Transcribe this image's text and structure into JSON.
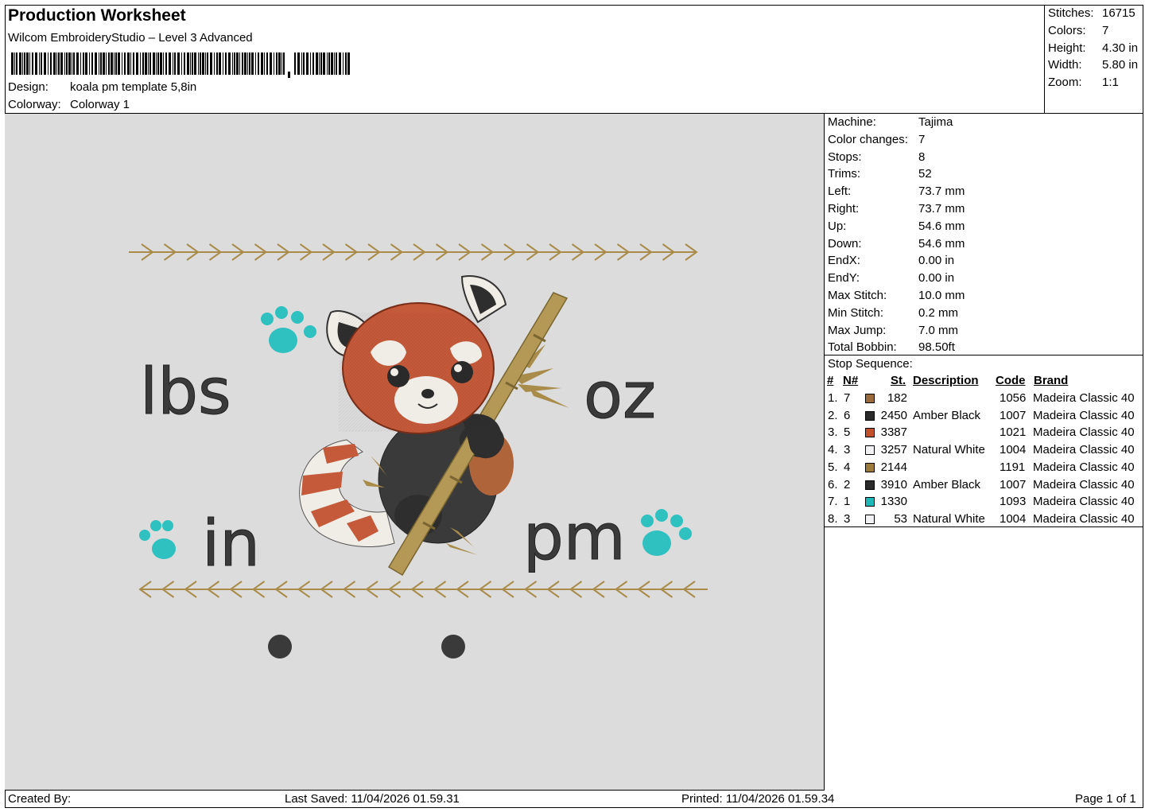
{
  "header": {
    "title": "Production Worksheet",
    "software": "Wilcom EmbroideryStudio – Level 3 Advanced",
    "design_label": "Design:",
    "design_value": "koala pm template 5,8in",
    "colorway_label": "Colorway:",
    "colorway_value": "Colorway 1"
  },
  "stats": [
    {
      "label": "Stitches:",
      "value": "16715"
    },
    {
      "label": "Colors:",
      "value": "7"
    },
    {
      "label": "Height:",
      "value": "4.30 in"
    },
    {
      "label": "Width:",
      "value": "5.80 in"
    },
    {
      "label": "Zoom:",
      "value": "1:1"
    }
  ],
  "machine_info": [
    {
      "label": "Machine:",
      "value": "Tajima"
    },
    {
      "label": "Color changes:",
      "value": "7"
    },
    {
      "label": "Stops:",
      "value": "8"
    },
    {
      "label": "Trims:",
      "value": "52"
    },
    {
      "label": "Left:",
      "value": "73.7 mm"
    },
    {
      "label": "Right:",
      "value": "73.7 mm"
    },
    {
      "label": "Up:",
      "value": "54.6 mm"
    },
    {
      "label": "Down:",
      "value": "54.6 mm"
    },
    {
      "label": "EndX:",
      "value": "0.00 in"
    },
    {
      "label": "EndY:",
      "value": "0.00 in"
    },
    {
      "label": "Max Stitch:",
      "value": "10.0 mm"
    },
    {
      "label": "Min Stitch:",
      "value": "0.2 mm"
    },
    {
      "label": "Max Jump:",
      "value": "7.0 mm"
    },
    {
      "label": "Total Bobbin:",
      "value": "98.50ft"
    }
  ],
  "stop_sequence": {
    "title": "Stop Sequence:",
    "columns": [
      "#",
      "N#",
      "St.",
      "Description",
      "Code",
      "Brand"
    ],
    "rows": [
      {
        "num": "1.",
        "n": "7",
        "color": "#9a6a3c",
        "st": "182",
        "desc": "",
        "code": "1056",
        "brand": "Madeira Classic 40"
      },
      {
        "num": "2.",
        "n": "6",
        "color": "#2a2a2a",
        "st": "2450",
        "desc": "Amber Black",
        "code": "1007",
        "brand": "Madeira Classic 40"
      },
      {
        "num": "3.",
        "n": "5",
        "color": "#c2502a",
        "st": "3387",
        "desc": "",
        "code": "1021",
        "brand": "Madeira Classic 40"
      },
      {
        "num": "4.",
        "n": "3",
        "color": "#f2f2f4",
        "st": "3257",
        "desc": "Natural White",
        "code": "1004",
        "brand": "Madeira Classic 40"
      },
      {
        "num": "5.",
        "n": "4",
        "color": "#9c7a3a",
        "st": "2144",
        "desc": "",
        "code": "1191",
        "brand": "Madeira Classic 40"
      },
      {
        "num": "6.",
        "n": "2",
        "color": "#2a2a2a",
        "st": "3910",
        "desc": "Amber Black",
        "code": "1007",
        "brand": "Madeira Classic 40"
      },
      {
        "num": "7.",
        "n": "1",
        "color": "#1fb8b8",
        "st": "1330",
        "desc": "",
        "code": "1093",
        "brand": "Madeira Classic 40"
      },
      {
        "num": "8.",
        "n": "3",
        "color": "#f2f2f4",
        "st": "53",
        "desc": "Natural White",
        "code": "1004",
        "brand": "Madeira Classic 40"
      }
    ]
  },
  "design": {
    "words": [
      "lbs",
      "oz",
      "in",
      "pm"
    ],
    "colors": {
      "dark": "#3a3a3a",
      "teal": "#2fc0c0",
      "rust": "#c45a3a",
      "cream": "#f0ece6",
      "bamboo": "#a98c4a",
      "canvas": "#dcdcdc"
    }
  },
  "footer": {
    "created_by": "Created By:",
    "last_saved": "Last Saved: 11/04/2026 01.59.31",
    "printed": "Printed: 11/04/2026 01.59.34",
    "page": "Page 1 of 1"
  }
}
